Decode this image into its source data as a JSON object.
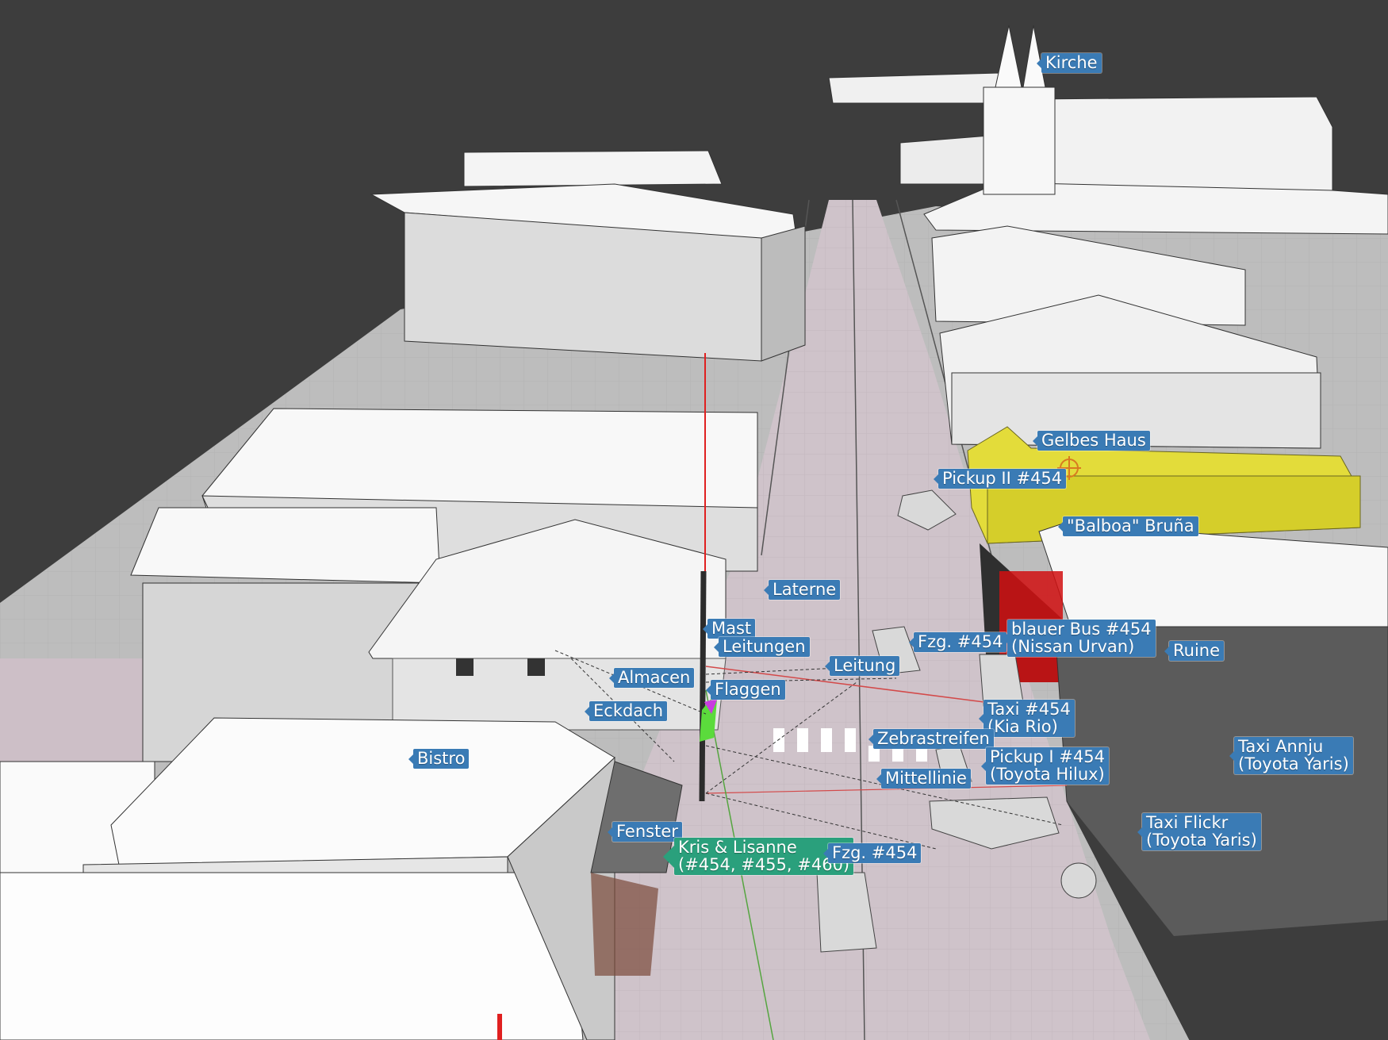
{
  "viewport": {
    "background": "#3d3d3d",
    "road_color": "#cfc3ca",
    "building_color": "#ececec",
    "highlight_color": "#e3dc3a",
    "label_color": "#3a7bb5",
    "active_label_color": "#2aa07c"
  },
  "labels": {
    "kirche": "Kirche",
    "gelbes_haus": "Gelbes Haus",
    "pickup_ii": "Pickup II #454",
    "balboa": "\"Balboa\" Bruña",
    "laterne": "Laterne",
    "mast": "Mast",
    "leitungen": "Leitungen",
    "fzg_top": "Fzg. #454",
    "blauer_bus": "blauer Bus #454\n(Nissan Urvan)",
    "ruine": "Ruine",
    "leitung": "Leitung",
    "almacen": "Almacen",
    "flaggen": "Flaggen",
    "eckdach": "Eckdach",
    "taxi_kia": "Taxi #454\n(Kia Rio)",
    "zebrastreifen": "Zebrastreifen",
    "bistro": "Bistro",
    "pickup_i": "Pickup I #454\n(Toyota Hilux)",
    "taxi_annju": "Taxi Annju\n(Toyota Yaris)",
    "mittellinie": "Mittellinie",
    "fenster": "Fenster",
    "kris_lisanne": "Kris & Lisanne\n(#454, #455, #460)",
    "fzg_bottom": "Fzg. #454",
    "taxi_flickr": "Taxi Flickr\n(Toyota Yaris)"
  }
}
